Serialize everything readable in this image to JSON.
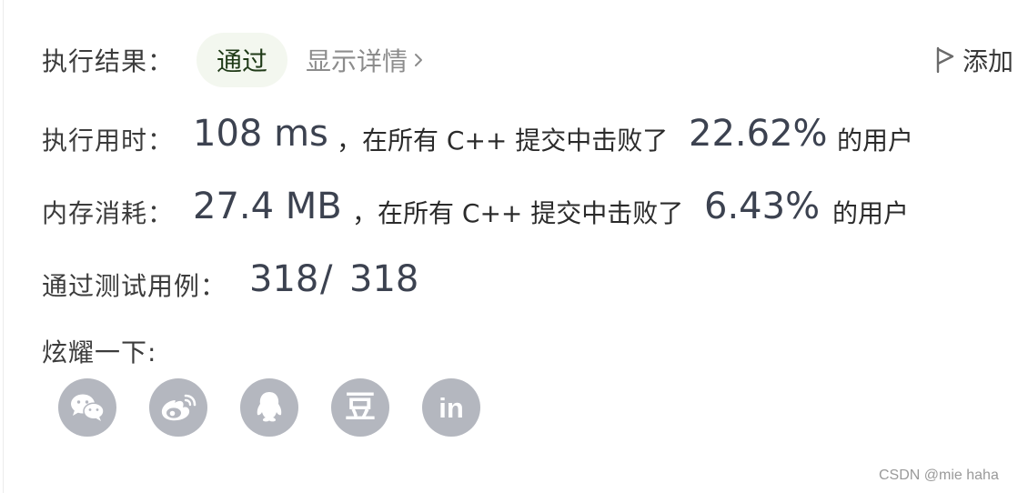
{
  "result": {
    "label": "执行结果：",
    "status": "通过",
    "details_link": "显示详情",
    "add_note": "添加"
  },
  "runtime": {
    "label": "执行用时：",
    "value": "108 ms",
    "text": "，在所有 C++ 提交中击败了",
    "percent": "22.62%",
    "suffix": "的用户"
  },
  "memory": {
    "label": "内存消耗：",
    "value": "27.4 MB",
    "text": "，在所有 C++ 提交中击败了",
    "percent": "6.43%",
    "suffix": "的用户"
  },
  "tests": {
    "label": "通过测试用例：",
    "passed": "318",
    "separator": "/",
    "total": "318"
  },
  "share": {
    "label": "炫耀一下:",
    "douban_glyph": "豆",
    "linkedin_glyph": "in",
    "icons": [
      "wechat-icon",
      "weibo-icon",
      "qq-icon",
      "douban-icon",
      "linkedin-icon"
    ]
  },
  "watermark": "CSDN @mie haha",
  "colors": {
    "pass_bg": "#f3f7ef",
    "share_icon_bg": "#b4b7bf"
  }
}
